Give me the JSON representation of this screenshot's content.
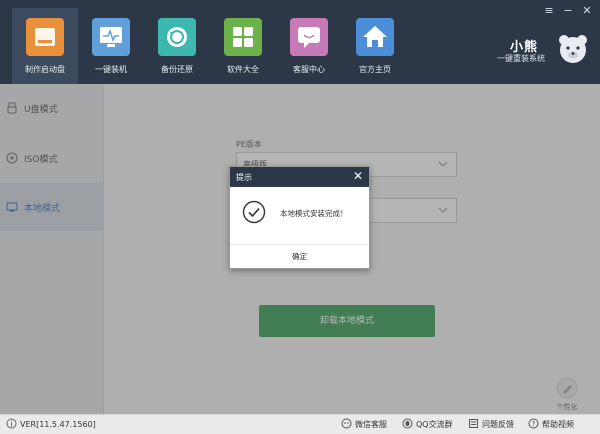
{
  "header": {
    "nav": [
      {
        "label": "制作启动盘",
        "icon": "usb-drive-icon",
        "color": "#e8903a"
      },
      {
        "label": "一键装机",
        "icon": "monitor-icon",
        "color": "#5fa0d8"
      },
      {
        "label": "备份还原",
        "icon": "restore-icon",
        "color": "#3cb8b0"
      },
      {
        "label": "软件大全",
        "icon": "apps-icon",
        "color": "#6cb14a"
      },
      {
        "label": "客服中心",
        "icon": "chat-icon",
        "color": "#c87ab8"
      },
      {
        "label": "官方主页",
        "icon": "home-icon",
        "color": "#4a8fd8"
      }
    ],
    "brand_title": "小熊",
    "brand_subtitle": "一键重装系统"
  },
  "sidebar": {
    "items": [
      {
        "label": "U盘模式",
        "icon": "usb-icon"
      },
      {
        "label": "ISO模式",
        "icon": "disc-icon"
      },
      {
        "label": "本地模式",
        "icon": "local-computer-icon"
      }
    ],
    "active_index": 2
  },
  "main": {
    "pe_label": "PE版本",
    "pe_select_value": "高级版",
    "second_select_value": "",
    "uninstall_label": "卸载本地模式",
    "personalize_label": "个性化"
  },
  "dialog": {
    "title": "提示",
    "message": "本地模式安装完成！",
    "ok_label": "确定"
  },
  "footer": {
    "version": "VER[11.5.47.1560]",
    "links": [
      {
        "label": "微信客服",
        "icon": "wechat-icon"
      },
      {
        "label": "QQ交流群",
        "icon": "qq-icon"
      },
      {
        "label": "问题反馈",
        "icon": "feedback-icon"
      },
      {
        "label": "帮助视频",
        "icon": "help-icon"
      }
    ]
  },
  "colors": {
    "header_bg": "#2c3848",
    "accent_green": "#2e9a4e",
    "active_blue": "#2a6bc0"
  }
}
